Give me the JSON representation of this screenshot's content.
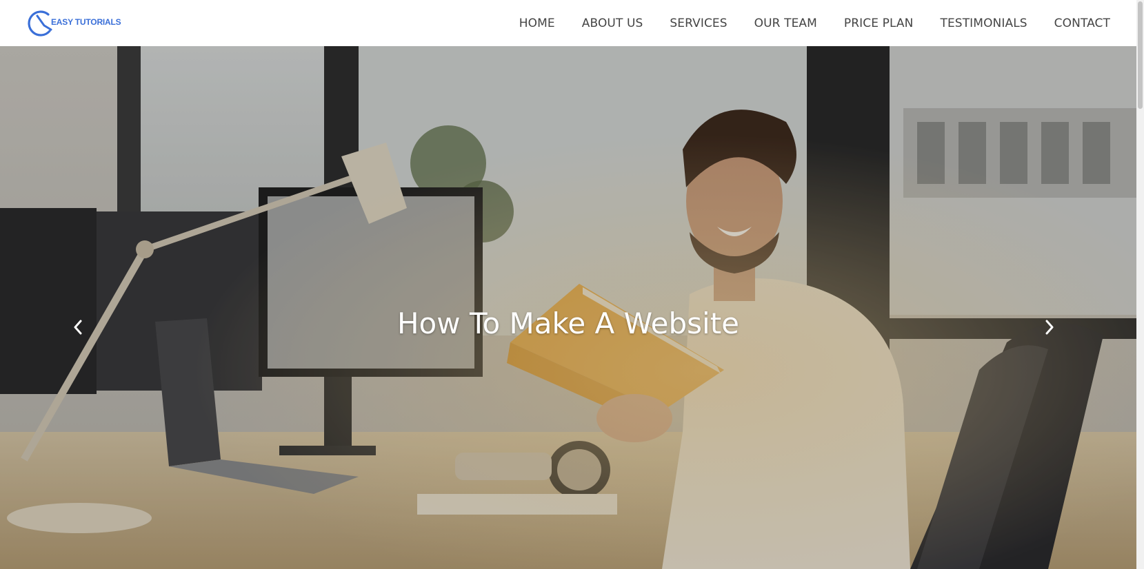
{
  "brand": {
    "logo_text": "eASY TUTORIALS",
    "accent_color": "#3a6fd8"
  },
  "nav": {
    "items": [
      {
        "label": "HOME"
      },
      {
        "label": "ABOUT US"
      },
      {
        "label": "SERVICES"
      },
      {
        "label": "OUR TEAM"
      },
      {
        "label": "PRICE PLAN"
      },
      {
        "label": "TESTIMONIALS"
      },
      {
        "label": "CONTACT"
      }
    ]
  },
  "hero": {
    "title": "How To Make A Website",
    "prev_icon": "chevron-left-icon",
    "next_icon": "chevron-right-icon",
    "image_subject": "man smiling at office desk holding a book"
  }
}
